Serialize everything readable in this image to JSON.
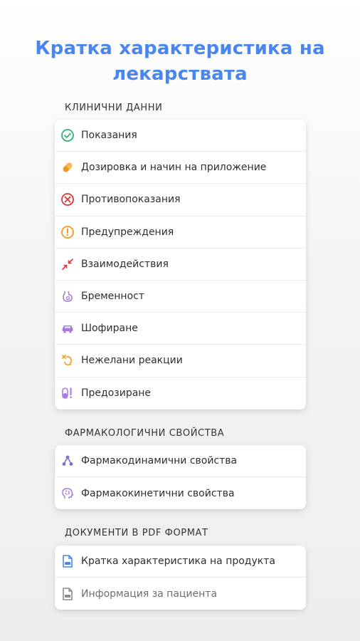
{
  "title": "Кратка характеристика на лекарствата",
  "sections": [
    {
      "header": "КЛИНИЧНИ ДАННИ",
      "items": [
        {
          "label": "Показания",
          "icon": "check-circle-icon",
          "color": "#2fb36b"
        },
        {
          "label": "Дозировка и начин на приложение",
          "icon": "pill-icon",
          "color": "#f39a1e"
        },
        {
          "label": "Противопоказания",
          "icon": "forbidden-circle-icon",
          "color": "#e0343a"
        },
        {
          "label": "Предупреждения",
          "icon": "warning-circle-icon",
          "color": "#f39a1e"
        },
        {
          "label": "Взаимодействия",
          "icon": "interaction-arrows-icon",
          "color": "#e0343a"
        },
        {
          "label": "Бременност",
          "icon": "pregnancy-icon",
          "color": "#a77be0"
        },
        {
          "label": "Шофиране",
          "icon": "car-icon",
          "color": "#a77be0"
        },
        {
          "label": "Нежелани реакции",
          "icon": "adverse-reaction-icon",
          "color": "#f39a1e"
        },
        {
          "label": "Предозиране",
          "icon": "overdose-icon",
          "color": "#a77be0"
        }
      ]
    },
    {
      "header": "ФАРМАКОЛОГИЧНИ СВОЙСТВА",
      "items": [
        {
          "label": "Фармакодинамични свойства",
          "icon": "molecule-icon",
          "color": "#7b6fd6"
        },
        {
          "label": "Фармакокинетични свойства",
          "icon": "head-cycle-icon",
          "color": "#a77be0"
        }
      ]
    },
    {
      "header": "ДОКУМЕНТИ В PDF ФОРМАТ",
      "items": [
        {
          "label": "Кратка характеристика на продукта",
          "icon": "pdf-document-icon",
          "color": "#4a86f0"
        },
        {
          "label": "Информация за пациента",
          "icon": "pdf-document-icon",
          "color": "#8a8a90"
        }
      ]
    }
  ]
}
